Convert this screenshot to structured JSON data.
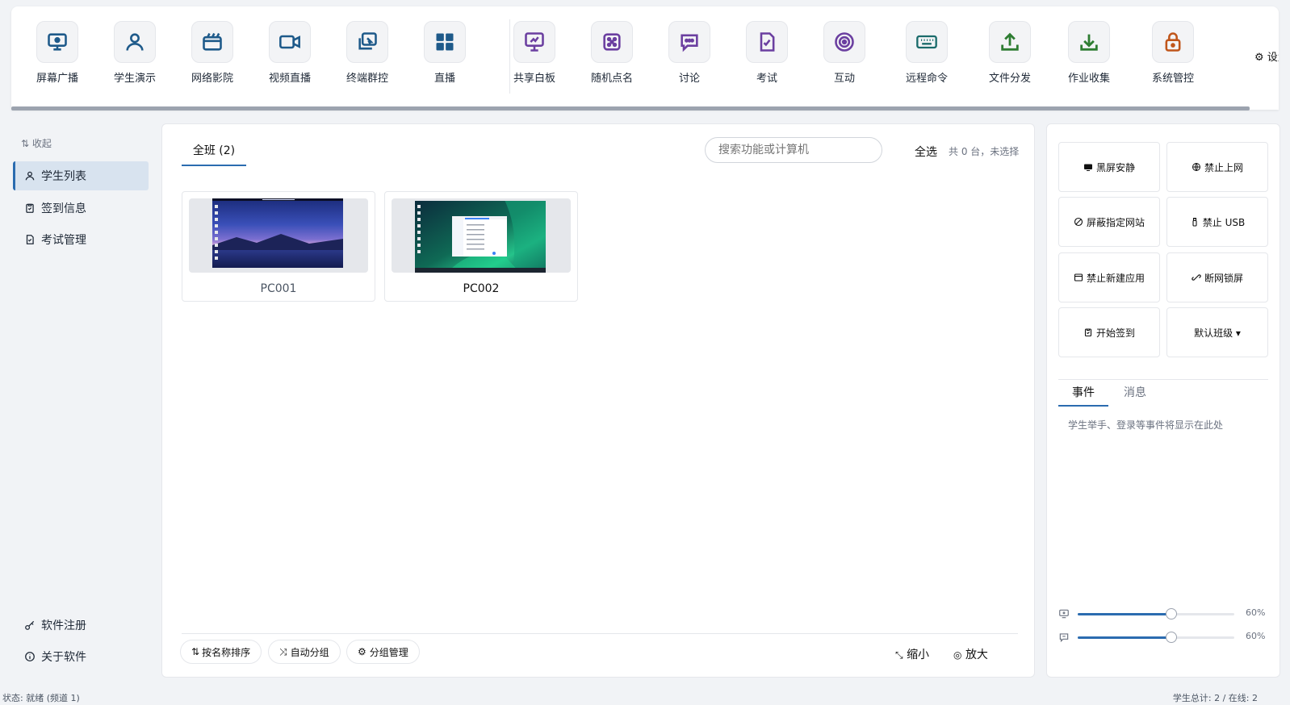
{
  "toolbar": {
    "tools": [
      {
        "label": "屏幕广播",
        "icon": "screen-broadcast-icon",
        "color": "#1e5a8a"
      },
      {
        "label": "学生演示",
        "icon": "student-demo-icon",
        "color": "#1e5a8a"
      },
      {
        "label": "网络影院",
        "icon": "network-cinema-icon",
        "color": "#1e5a8a"
      },
      {
        "label": "视频直播",
        "icon": "video-live-icon",
        "color": "#1e5a8a"
      },
      {
        "label": "终端群控",
        "icon": "terminal-group-control-icon",
        "color": "#1e5a8a"
      },
      {
        "label": "直播",
        "icon": "live-grid-icon",
        "color": "#1e5a8a"
      },
      {
        "label": "共享白板",
        "icon": "shared-whiteboard-icon",
        "color": "#6b3fa0"
      },
      {
        "label": "随机点名",
        "icon": "random-roll-call-icon",
        "color": "#6b3fa0"
      },
      {
        "label": "讨论",
        "icon": "discussion-icon",
        "color": "#6b3fa0"
      },
      {
        "label": "考试",
        "icon": "exam-icon",
        "color": "#6b3fa0"
      },
      {
        "label": "互动",
        "icon": "interaction-icon",
        "color": "#6b3fa0"
      },
      {
        "label": "远程命令",
        "icon": "remote-command-icon",
        "color": "#1a6b6b"
      },
      {
        "label": "文件分发",
        "icon": "file-distribute-icon",
        "color": "#2e7d32"
      },
      {
        "label": "作业收集",
        "icon": "homework-collect-icon",
        "color": "#2e7d32"
      },
      {
        "label": "系统管控",
        "icon": "system-control-icon",
        "color": "#c0561b"
      }
    ],
    "settings_label": "⚙ 设置"
  },
  "sidebar": {
    "collapse_label": "⇅ 收起",
    "items": [
      {
        "label": "学生列表",
        "icon": "person-icon",
        "active": true
      },
      {
        "label": "签到信息",
        "icon": "clipboard-check-icon",
        "active": false
      },
      {
        "label": "考试管理",
        "icon": "exam-doc-icon",
        "active": false
      }
    ],
    "bottom_items": [
      {
        "label": "软件注册",
        "icon": "key-icon"
      },
      {
        "label": "关于软件",
        "icon": "info-icon"
      }
    ]
  },
  "main": {
    "tab_label": "全班 (2)",
    "search_placeholder": "搜索功能或计算机",
    "select_all_label": "全选",
    "selection_status": "共 0 台，未选择",
    "computers": [
      {
        "name": "PC001",
        "wallpaper": "night-lake"
      },
      {
        "name": "PC002",
        "wallpaper": "aurora"
      }
    ],
    "footer": {
      "sort_label": "按名称排序",
      "auto_group_label": "自动分组",
      "group_manage_label": "分组管理",
      "zoom_out_label": "缩小",
      "zoom_in_label": "放大"
    }
  },
  "right_panel": {
    "quick_actions": [
      {
        "label": "黑屏安静",
        "icon": "black-screen-icon"
      },
      {
        "label": "禁止上网",
        "icon": "globe-icon"
      },
      {
        "label": "屏蔽指定网站",
        "icon": "block-icon"
      },
      {
        "label": "禁止 USB",
        "icon": "usb-icon"
      },
      {
        "label": "禁止新建应用",
        "icon": "app-window-icon"
      },
      {
        "label": "断网锁屏",
        "icon": "unlink-icon"
      },
      {
        "label": "开始签到",
        "icon": "clipboard-check-icon"
      },
      {
        "label": "默认班级 ▾",
        "icon": ""
      }
    ],
    "event_tabs": [
      {
        "label": "事件",
        "active": true
      },
      {
        "label": "消息",
        "active": false
      }
    ],
    "event_empty_text": "学生举手、登录等事件将显示在此处",
    "sliders": [
      {
        "icon": "monitor-small-icon",
        "value_label": "60%",
        "value": 0.6
      },
      {
        "icon": "chat-small-icon",
        "value_label": "60%",
        "value": 0.6
      }
    ]
  },
  "status_bar": {
    "left": "状态: 就绪 (频道 1)",
    "right": "学生总计: 2 / 在线: 2"
  },
  "colors": {
    "accent": "#2b6cb0",
    "active_nav_bg": "#d8e3ef"
  }
}
